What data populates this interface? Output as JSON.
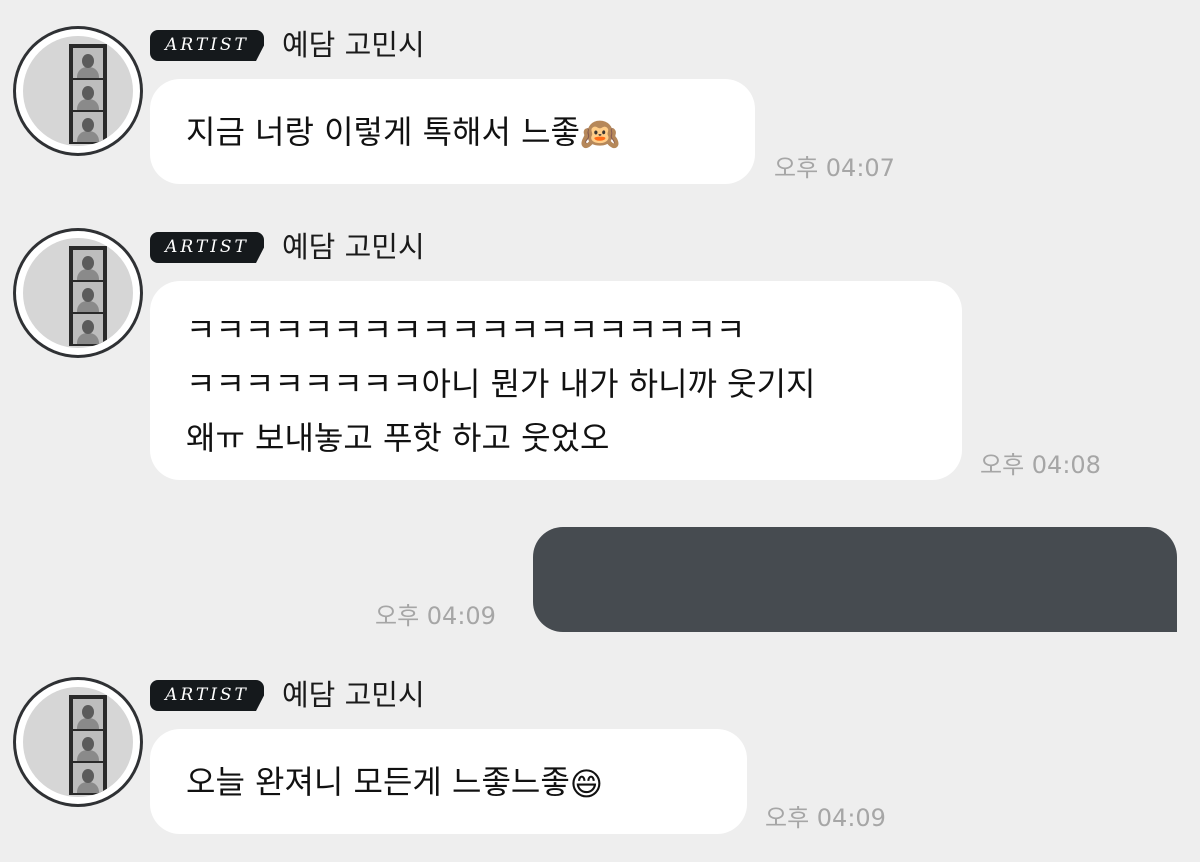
{
  "chat": {
    "messages": [
      {
        "badge": "ARTIST",
        "sender": "예담 고민시",
        "lines": [
          "지금 너랑 이렇게 톡해서 느좋"
        ],
        "emoji": "🙉",
        "emoji_name": "hear-no-evil-monkey",
        "time": "오후 04:07"
      },
      {
        "badge": "ARTIST",
        "sender": "예담 고민시",
        "lines": [
          "ㅋㅋㅋㅋㅋㅋㅋㅋㅋㅋㅋㅋㅋㅋㅋㅋㅋㅋㅋ",
          "ㅋㅋㅋㅋㅋㅋㅋㅋ아니 뭔가 내가 하니까 웃기지",
          "왜ㅠ 보내놓고 푸핫 하고 웃었오"
        ],
        "time": "오후 04:08"
      },
      {
        "mine": true,
        "content_hidden": true,
        "time": "오후 04:09"
      },
      {
        "badge": "ARTIST",
        "sender": "예담 고민시",
        "lines": [
          "오늘 완져니 모든게 느좋느좋"
        ],
        "emoji": "😄",
        "emoji_name": "grinning-face",
        "time": "오후 04:09"
      }
    ]
  },
  "colors": {
    "background": "#eeeeee",
    "incoming_bubble": "#ffffff",
    "outgoing_bubble": "#464b50",
    "badge": "#15191c",
    "timestamp": "#a6a6a6"
  }
}
